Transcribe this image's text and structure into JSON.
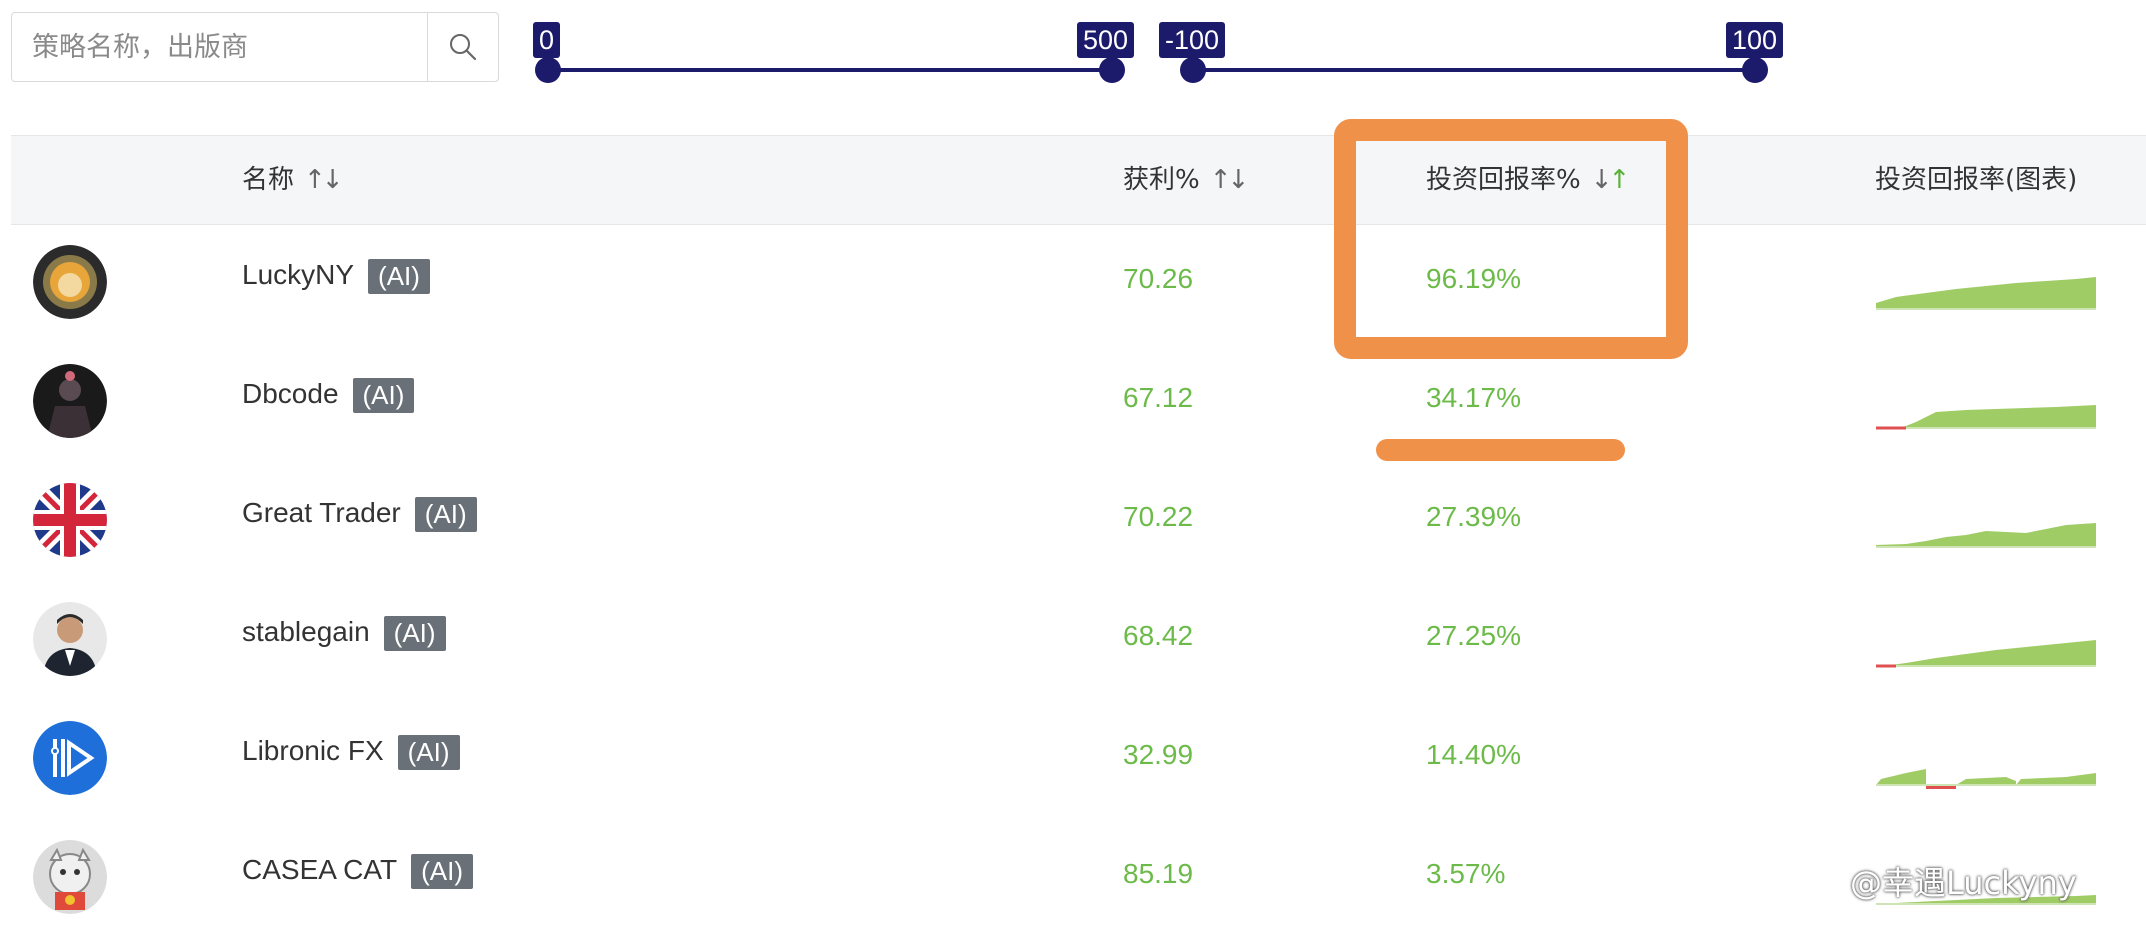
{
  "search": {
    "placeholder": "策略名称，出版商"
  },
  "slider_a": {
    "min_label": "0",
    "max_label": "500"
  },
  "slider_b": {
    "min_label": "-100",
    "max_label": "100"
  },
  "columns": {
    "name": "名称",
    "profit": "获利%",
    "roi": "投资回报率%",
    "roi_chart": "投资回报率(图表)"
  },
  "badge_label": "(AI)",
  "rows": [
    {
      "name": "LuckyNY",
      "profit": "70.26",
      "roi": "96.19%"
    },
    {
      "name": "Dbcode",
      "profit": "67.12",
      "roi": "34.17%"
    },
    {
      "name": "Great Trader",
      "profit": "70.22",
      "roi": "27.39%"
    },
    {
      "name": "stablegain",
      "profit": "68.42",
      "roi": "27.25%"
    },
    {
      "name": "Libronic FX",
      "profit": "32.99",
      "roi": "14.40%"
    },
    {
      "name": "CASEA CAT",
      "profit": "85.19",
      "roi": "3.57%"
    }
  ],
  "watermark": "@幸遇Luckyny",
  "colors": {
    "accent": "#1c1a6b",
    "positive": "#6cbb4a",
    "highlight": "#f0914a",
    "badge": "#6a7078"
  }
}
